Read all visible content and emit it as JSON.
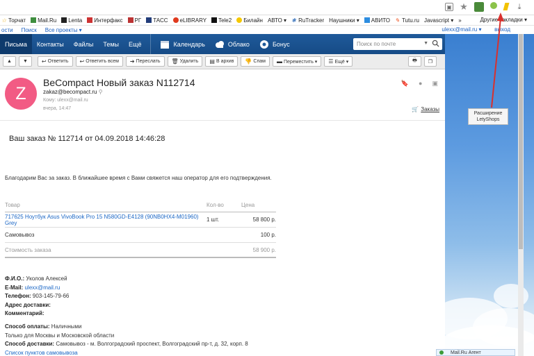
{
  "browser": {
    "extension_tooltip": [
      "Расширение",
      "LetyShops"
    ]
  },
  "bookmarks": {
    "items": [
      "Торчат",
      "Mail.Ru",
      "Lenta",
      "Интерфакс",
      "РГ",
      "ТАСС",
      "eLIBRARY",
      "Tele2",
      "Билайн",
      "АВТО ▾",
      "RuTracker",
      "Наушники ▾",
      "АВИТО",
      "Tutu.ru",
      "Javascript ▾",
      "»"
    ],
    "other": "Другие закладки ▾"
  },
  "topstrip": {
    "left": [
      "ости",
      "Поиск",
      "Все проекты ▾"
    ],
    "user": "ulexx@mail.ru ▾",
    "logout": "выход"
  },
  "header": {
    "nav": [
      "Письма",
      "Контакты",
      "Файлы",
      "Темы",
      "Ещё"
    ],
    "calendar": "Календарь",
    "cloud": "Облако",
    "bonus": "Бонус",
    "search_placeholder": "Поиск по почте"
  },
  "toolbar": {
    "reply": "Ответить",
    "reply_all": "Ответить всем",
    "forward": "Переслать",
    "delete": "Удалить",
    "archive": "В архив",
    "spam": "Спам",
    "move": "Переместить ▾",
    "more": "Ещё ▾"
  },
  "message": {
    "avatar_letter": "Z",
    "subject": "BeCompact Новый заказ N112714",
    "from": "zakaz@becompact.ru",
    "to": "Кому: ulexx@mail.ru",
    "date": "вчера, 14:47",
    "orders_label": "Заказы",
    "order_title": "Ваш заказ № 112714 от 04.09.2018 14:46:28",
    "thanks": "Благодарим Вас за заказ. В ближайшее время с Вами свяжется наш оператор для его подтверждения.",
    "table": {
      "headers": [
        "Товар",
        "Кол-во",
        "Цена"
      ],
      "rows": [
        [
          "717625 Ноутбук Asus VivoBook Pro 15 N580GD-E4128 (90NB0HX4-M01960) Grey",
          "1 шт.",
          "58 800 р."
        ],
        [
          "Самовывоз",
          "",
          "100 р."
        ]
      ],
      "total": [
        "Стоимость заказа",
        "",
        "58 900 р."
      ]
    },
    "info": {
      "fio_label": "Ф.И.О.:",
      "fio": "Уколов Алексей",
      "email_label": "E-Mail:",
      "email": "ulexx@mail.ru",
      "phone_label": "Телефон:",
      "phone": "903-145-79-66",
      "address_label": "Адрес доставки:",
      "comment_label": "Комментарий:",
      "pay_label": "Способ оплаты:",
      "pay": "Наличными",
      "region": "Только для Москвы и Московской области",
      "delivery_label": "Способ доставки:",
      "delivery": "Самовывоз - м. Волгоградский проспект, Волгоградский пр-т, д. 32, корп. 8",
      "pickup_link": "Список пунктов самовывоза"
    }
  },
  "agent": "Mail.Ru Агент",
  "colors": {
    "header_blue": "#1f5a9a",
    "avatar": "#f25b84",
    "link": "#1a66c5",
    "arrow": "#d9302c"
  }
}
